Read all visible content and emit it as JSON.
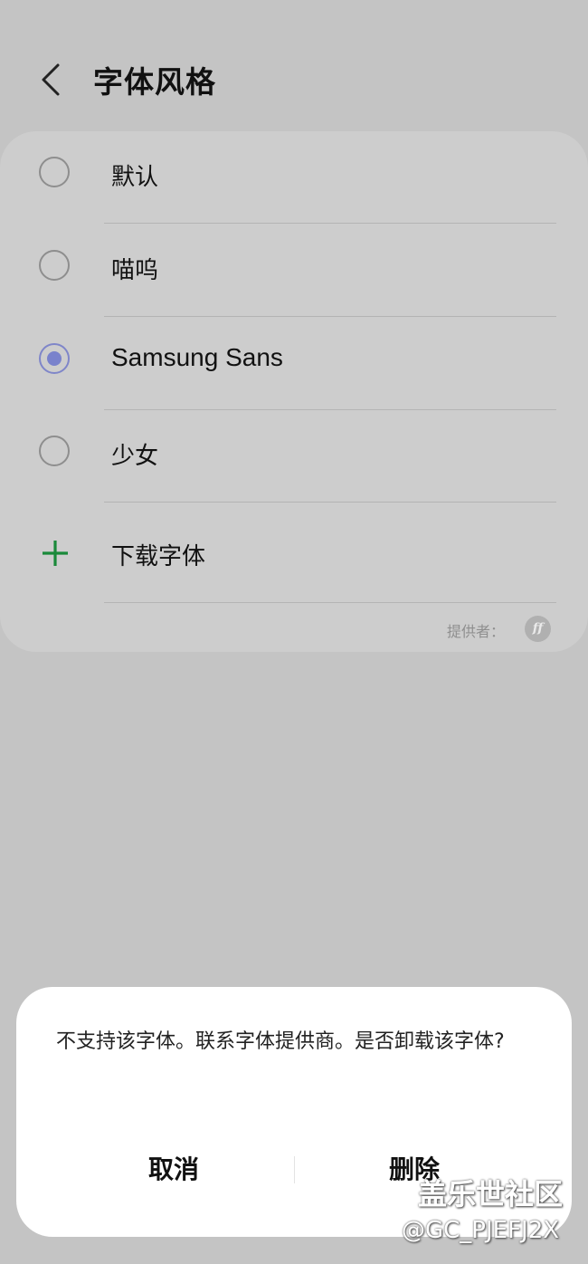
{
  "header": {
    "title": "字体风格"
  },
  "fonts": [
    {
      "label": "默认",
      "selected": false
    },
    {
      "label": "喵呜",
      "selected": false
    },
    {
      "label": "Samsung Sans",
      "selected": true
    },
    {
      "label": "少女",
      "selected": false
    }
  ],
  "download": {
    "label": "下载字体"
  },
  "provider": {
    "label": "提供者：",
    "logo": "ff"
  },
  "dialog": {
    "message": "不支持该字体。联系字体提供商。是否卸载该字体?",
    "cancel": "取消",
    "delete": "删除"
  },
  "watermark": {
    "line1": "盖乐世社区",
    "line2": "@GC_PJEFJ2X"
  },
  "colors": {
    "accent": "#7982cc",
    "download_plus": "#1a8a3a",
    "background": "#c4c4c4",
    "dialog": "#ffffff"
  }
}
